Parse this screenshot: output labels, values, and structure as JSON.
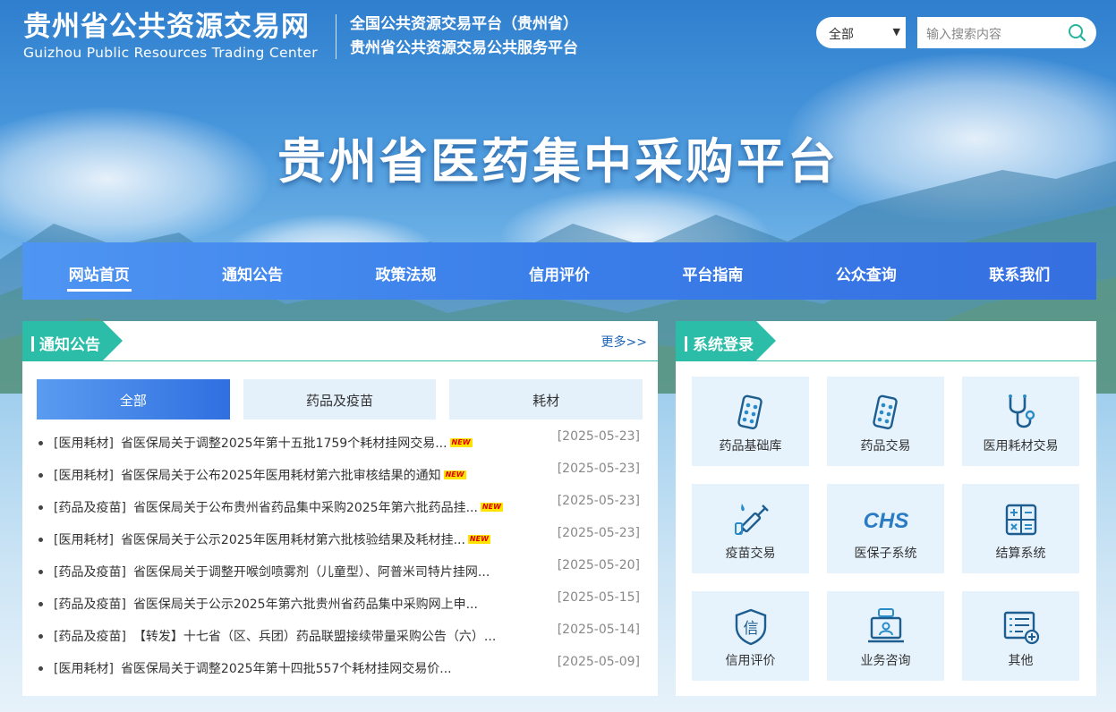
{
  "header": {
    "brand_cn": "贵州省公共资源交易网",
    "brand_en": "Guizhou Public Resources Trading Center",
    "sub_line1": "全国公共资源交易平台（贵州省）",
    "sub_line2": "贵州省公共资源交易公共服务平台",
    "search_select": "全部",
    "search_placeholder": "输入搜索内容"
  },
  "hero_title": "贵州省医药集中采购平台",
  "nav": [
    "网站首页",
    "通知公告",
    "政策法规",
    "信用评价",
    "平台指南",
    "公众查询",
    "联系我们"
  ],
  "notices": {
    "title": "通知公告",
    "more": "更多>>",
    "tabs": [
      "全部",
      "药品及疫苗",
      "耗材"
    ],
    "new_badge": "NEW",
    "items": [
      {
        "cat": "[医用耗材]",
        "title": "省医保局关于调整2025年第十五批1759个耗材挂网交易...",
        "new": true,
        "date": "[2025-05-23]"
      },
      {
        "cat": "[医用耗材]",
        "title": "省医保局关于公布2025年医用耗材第六批审核结果的通知",
        "new": true,
        "date": "[2025-05-23]"
      },
      {
        "cat": "[药品及疫苗]",
        "title": "省医保局关于公布贵州省药品集中采购2025年第六批药品挂...",
        "new": true,
        "date": "[2025-05-23]"
      },
      {
        "cat": "[医用耗材]",
        "title": "省医保局关于公示2025年医用耗材第六批核验结果及耗材挂...",
        "new": true,
        "date": "[2025-05-23]"
      },
      {
        "cat": "[药品及疫苗]",
        "title": "省医保局关于调整开喉剑喷雾剂（儿童型）、阿普米司特片挂网...",
        "new": false,
        "date": "[2025-05-20]"
      },
      {
        "cat": "[药品及疫苗]",
        "title": "省医保局关于公示2025年第六批贵州省药品集中采购网上申...",
        "new": false,
        "date": "[2025-05-15]"
      },
      {
        "cat": "[药品及疫苗]",
        "title": "【转发】十七省（区、兵团）药品联盟接续带量采购公告（六）...",
        "new": false,
        "date": "[2025-05-14]"
      },
      {
        "cat": "[医用耗材]",
        "title": "省医保局关于调整2025年第十四批557个耗材挂网交易价...",
        "new": false,
        "date": "[2025-05-09]"
      }
    ]
  },
  "login": {
    "title": "系统登录",
    "systems": [
      {
        "label": "药品基础库",
        "icon": "pill-blister-icon"
      },
      {
        "label": "药品交易",
        "icon": "pill-blister-icon"
      },
      {
        "label": "医用耗材交易",
        "icon": "stethoscope-icon"
      },
      {
        "label": "疫苗交易",
        "icon": "syringe-icon"
      },
      {
        "label": "医保子系统",
        "icon": "chs-logo-icon"
      },
      {
        "label": "结算系统",
        "icon": "calculator-icon"
      },
      {
        "label": "信用评价",
        "icon": "credit-shield-icon"
      },
      {
        "label": "业务咨询",
        "icon": "consult-computer-icon"
      },
      {
        "label": "其他",
        "icon": "list-plus-icon"
      }
    ]
  },
  "colors": {
    "nav": "#3a7ee9",
    "teal": "#2bbda8",
    "icon": "#1d5d8f"
  }
}
